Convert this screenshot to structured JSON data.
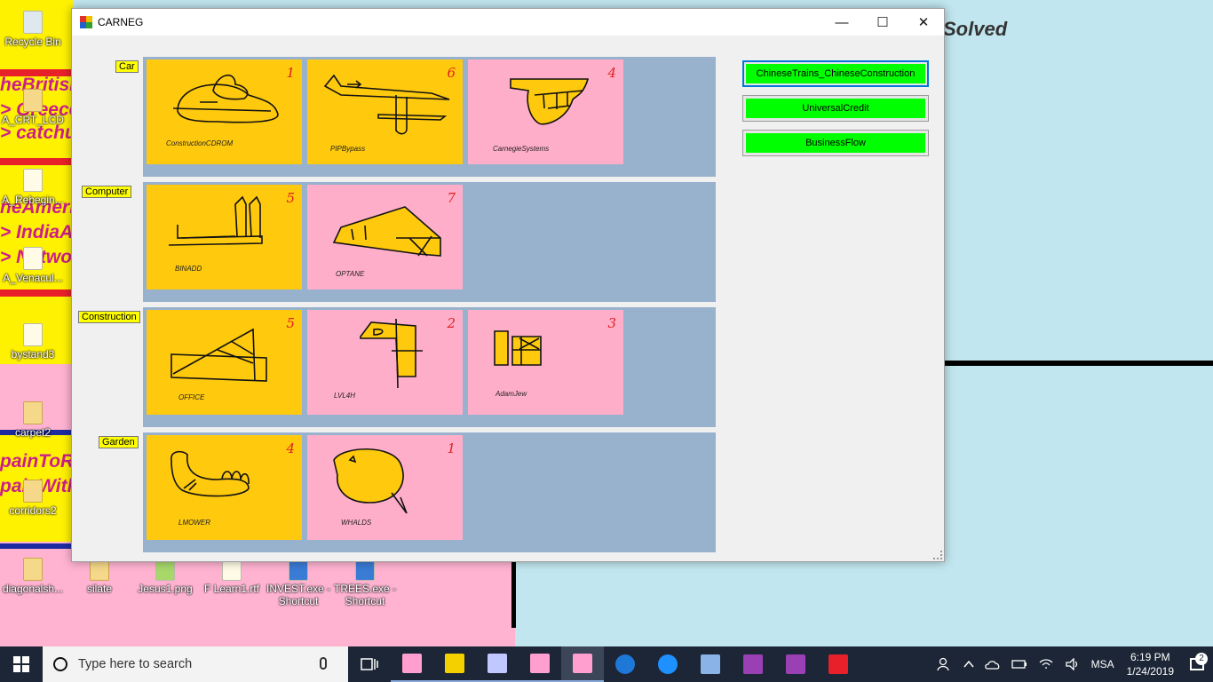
{
  "window": {
    "title": "CARNEG",
    "minimize": "—",
    "maximize": "☐",
    "close": "✕"
  },
  "desktop": {
    "solved_text": "Solved",
    "bg_texts": [
      "heBritish",
      "> Greece",
      "> catchu",
      "heAmeri",
      "> IndiaA",
      "> Netwo",
      "painToRu",
      "painWith"
    ],
    "icons": [
      {
        "label": "Recycle Bin"
      },
      {
        "label": "A_CRT_LCD"
      },
      {
        "label": "A_Rebegin..."
      },
      {
        "label": "A_Venacul..."
      },
      {
        "label": "bystand3"
      },
      {
        "label": "carpet2"
      },
      {
        "label": "corridors2"
      },
      {
        "label": "diagonalsh..."
      },
      {
        "label": "silate"
      },
      {
        "label": "Jesus1.png"
      },
      {
        "label": "F Learn1.rtf"
      },
      {
        "label": "INVEST.exe - Shortcut"
      },
      {
        "label": "TREES.exe - Shortcut"
      }
    ]
  },
  "rows": [
    {
      "label": "Car",
      "cards": [
        {
          "name": "ConstructionCDROM",
          "count": "1",
          "color": "#ffc90e"
        },
        {
          "name": "PIPBypass",
          "count": "6",
          "color": "#ffc90e"
        },
        {
          "name": "CarnegieSystems",
          "count": "4",
          "color": "#ffaec9"
        }
      ]
    },
    {
      "label": "Computer",
      "cards": [
        {
          "name": "BINADD",
          "count": "5",
          "color": "#ffc90e"
        },
        {
          "name": "OPTANE",
          "count": "7",
          "color": "#ffaec9"
        }
      ]
    },
    {
      "label": "Construction",
      "cards": [
        {
          "name": "OFFICE",
          "count": "5",
          "color": "#ffc90e"
        },
        {
          "name": "LVL4H",
          "count": "2",
          "color": "#ffaec9"
        },
        {
          "name": "AdamJew",
          "count": "3",
          "color": "#ffaec9"
        }
      ]
    },
    {
      "label": "Garden",
      "cards": [
        {
          "name": "LMOWER",
          "count": "4",
          "color": "#ffc90e"
        },
        {
          "name": "WHALDS",
          "count": "1",
          "color": "#ffaec9"
        }
      ]
    }
  ],
  "actions": [
    {
      "label": "ChineseTrains_ChineseConstruction"
    },
    {
      "label": "UniversalCredit"
    },
    {
      "label": "BusinessFlow"
    }
  ],
  "taskbar": {
    "search_placeholder": "Type here to search",
    "language": "MSA",
    "time": "6:19 PM",
    "date": "1/24/2019",
    "notification_count": "2"
  }
}
